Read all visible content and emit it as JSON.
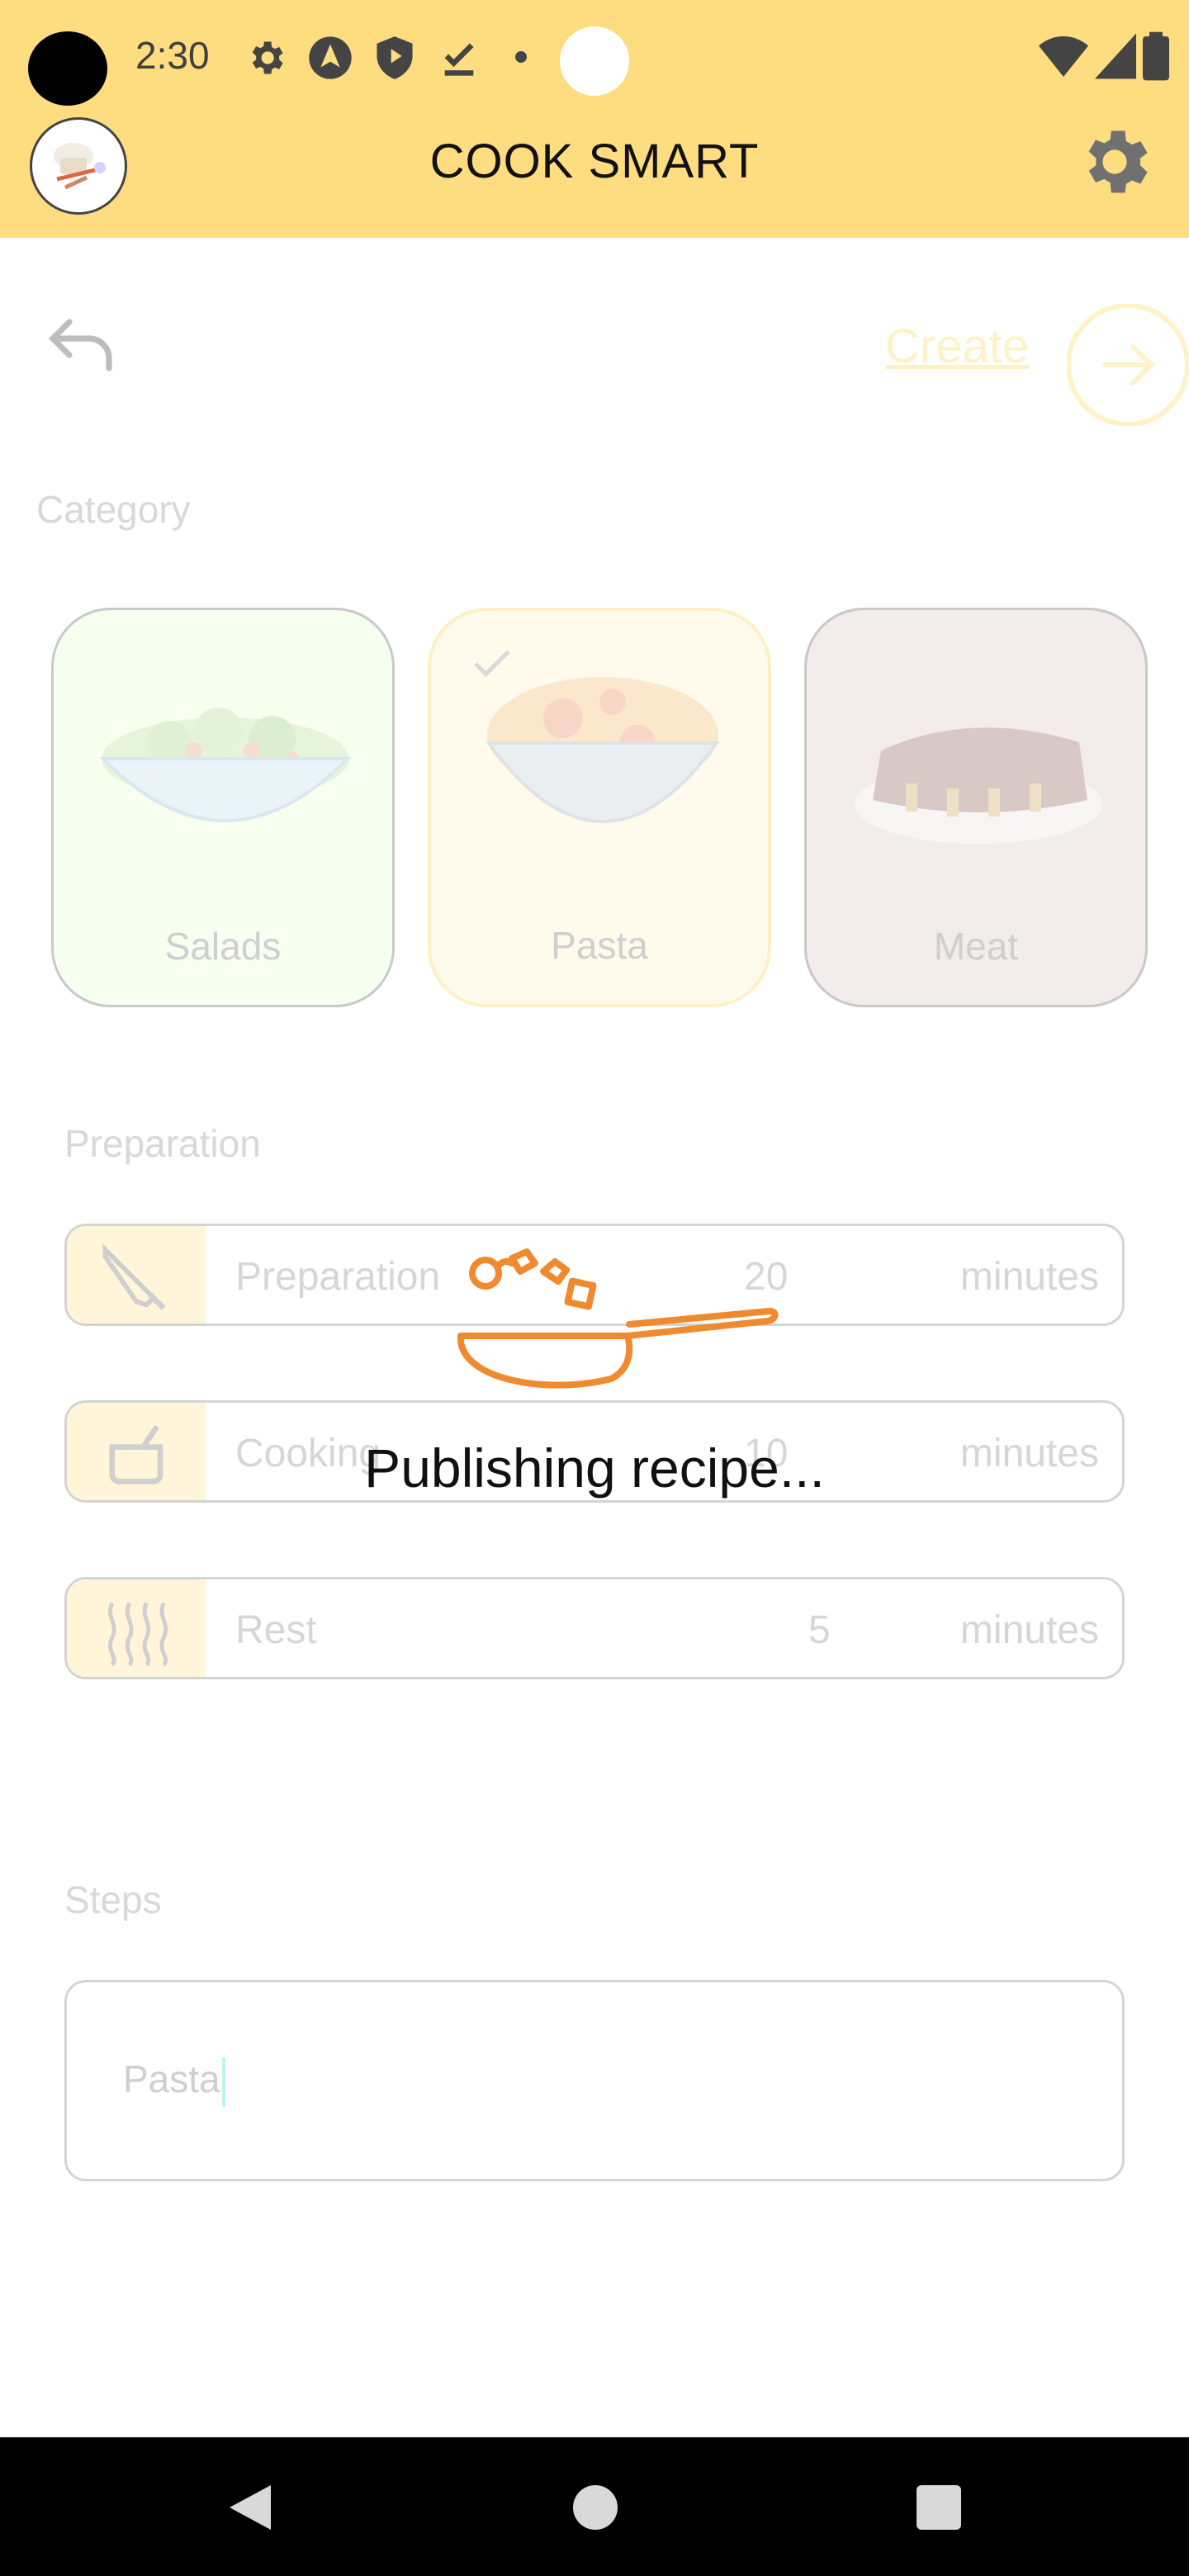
{
  "status_bar": {
    "time": "2:30",
    "icons": [
      "gear-icon",
      "navigation-icon",
      "shield-icon",
      "download-done-icon",
      "dot-icon",
      "wifi-icon",
      "signal-icon",
      "battery-icon"
    ]
  },
  "app_bar": {
    "title": "COOK SMART",
    "avatar_icon": "chef-avatar-icon",
    "settings_icon": "gear-icon"
  },
  "toolbar": {
    "undo_icon": "undo-icon",
    "create_label": "Create",
    "create_icon": "arrow-right-circle-icon"
  },
  "category": {
    "label": "Category",
    "items": [
      {
        "label": "Salads",
        "selected": false
      },
      {
        "label": "Pasta",
        "selected": true
      },
      {
        "label": "Meat",
        "selected": false
      }
    ]
  },
  "preparation": {
    "label": "Preparation",
    "rows": [
      {
        "icon": "knife-icon",
        "label": "Preparation",
        "value": "20",
        "unit": "minutes"
      },
      {
        "icon": "pot-icon",
        "label": "Cooking",
        "value": "10",
        "unit": "minutes"
      },
      {
        "icon": "steam-icon",
        "label": "Rest",
        "value": "5",
        "unit": "minutes"
      }
    ]
  },
  "steps": {
    "label": "Steps",
    "value": "Pasta"
  },
  "overlay": {
    "message": "Publishing recipe...",
    "icon": "frying-pan-icon",
    "accent": "#F08A2E"
  },
  "nav_bar": {
    "back_icon": "back-triangle-icon",
    "home_icon": "home-circle-icon",
    "recents_icon": "recents-square-icon"
  }
}
